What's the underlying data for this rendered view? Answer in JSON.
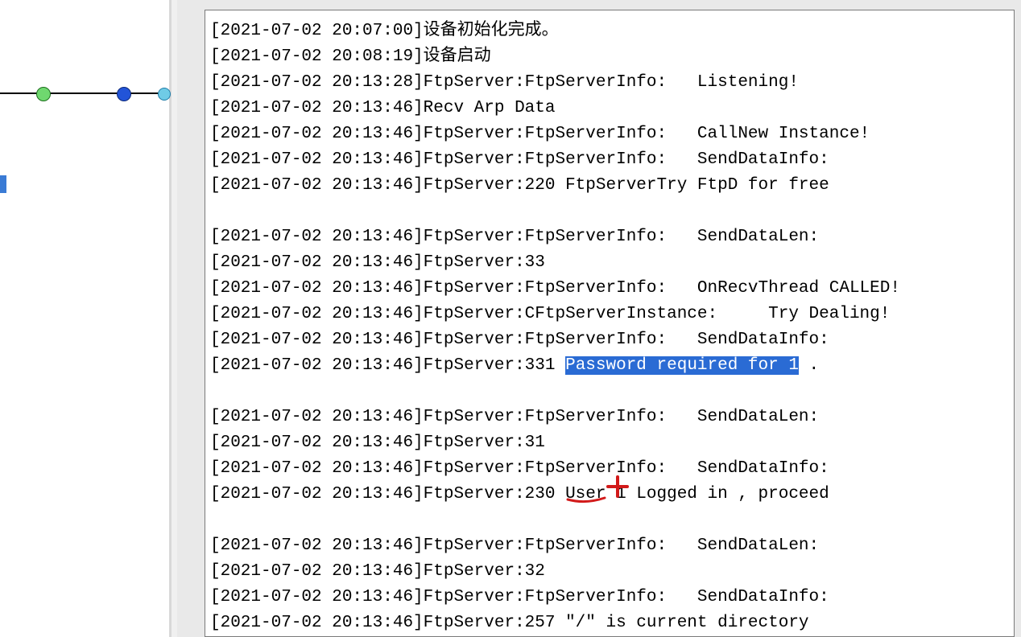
{
  "log": {
    "lines": [
      {
        "ts": "[2021-07-02 20:07:00]",
        "msg": "设备初始化完成。"
      },
      {
        "ts": "[2021-07-02 20:08:19]",
        "msg": "设备启动"
      },
      {
        "ts": "[2021-07-02 20:13:28]",
        "msg": "FtpServer:FtpServerInfo:   Listening!"
      },
      {
        "ts": "[2021-07-02 20:13:46]",
        "msg": "Recv Arp Data"
      },
      {
        "ts": "[2021-07-02 20:13:46]",
        "msg": "FtpServer:FtpServerInfo:   CallNew Instance!"
      },
      {
        "ts": "[2021-07-02 20:13:46]",
        "msg": "FtpServer:FtpServerInfo:   SendDataInfo:"
      },
      {
        "ts": "[2021-07-02 20:13:46]",
        "msg": "FtpServer:220 FtpServerTry FtpD for free"
      },
      {
        "blank": true
      },
      {
        "ts": "[2021-07-02 20:13:46]",
        "msg": "FtpServer:FtpServerInfo:   SendDataLen:"
      },
      {
        "ts": "[2021-07-02 20:13:46]",
        "msg": "FtpServer:33"
      },
      {
        "ts": "[2021-07-02 20:13:46]",
        "msg": "FtpServer:FtpServerInfo:   OnRecvThread CALLED!"
      },
      {
        "ts": "[2021-07-02 20:13:46]",
        "msg": "FtpServer:CFtpServerInstance:     Try Dealing!"
      },
      {
        "ts": "[2021-07-02 20:13:46]",
        "msg": "FtpServer:FtpServerInfo:   SendDataInfo:"
      },
      {
        "ts": "[2021-07-02 20:13:46]",
        "msg_before": "FtpServer:331 ",
        "sel": "Password required for 1",
        "msg_after": " ."
      },
      {
        "blank": true
      },
      {
        "ts": "[2021-07-02 20:13:46]",
        "msg": "FtpServer:FtpServerInfo:   SendDataLen:"
      },
      {
        "ts": "[2021-07-02 20:13:46]",
        "msg": "FtpServer:31"
      },
      {
        "ts": "[2021-07-02 20:13:46]",
        "msg": "FtpServer:FtpServerInfo:   SendDataInfo:"
      },
      {
        "ts": "[2021-07-02 20:13:46]",
        "msg": "FtpServer:230 User 1 Logged in , proceed",
        "annotated": true
      },
      {
        "blank": true
      },
      {
        "ts": "[2021-07-02 20:13:46]",
        "msg": "FtpServer:FtpServerInfo:   SendDataLen:"
      },
      {
        "ts": "[2021-07-02 20:13:46]",
        "msg": "FtpServer:32"
      },
      {
        "ts": "[2021-07-02 20:13:46]",
        "msg": "FtpServer:FtpServerInfo:   SendDataInfo:"
      },
      {
        "ts": "[2021-07-02 20:13:46]",
        "msg": "FtpServer:257 \"/\" is current directory"
      }
    ]
  },
  "colors": {
    "selection_bg": "#2a6bd4",
    "selection_fg": "#ffffff",
    "annotation": "#d21a1a"
  }
}
